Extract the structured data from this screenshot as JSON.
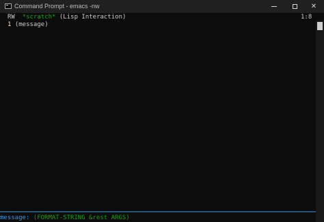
{
  "window": {
    "title": "Command Prompt - emacs  -nw"
  },
  "header": {
    "status": "RW",
    "buffer_name": "*scratch*",
    "mode": "(Lisp Interaction)",
    "position": "1:8"
  },
  "editor": {
    "lines": [
      {
        "number": "1",
        "text": "(message)"
      }
    ]
  },
  "echo_area": {
    "function": "message:",
    "signature": "(FORMAT-STRING &rest ARGS)"
  },
  "colors": {
    "background": "#0c0c0c",
    "titlebar": "#202020",
    "green": "#13a10e",
    "blue": "#3a96dd",
    "yellow": "#f9f1a5"
  },
  "icons": [
    "terminal-app-icon",
    "minimize-icon",
    "maximize-icon",
    "close-icon"
  ]
}
